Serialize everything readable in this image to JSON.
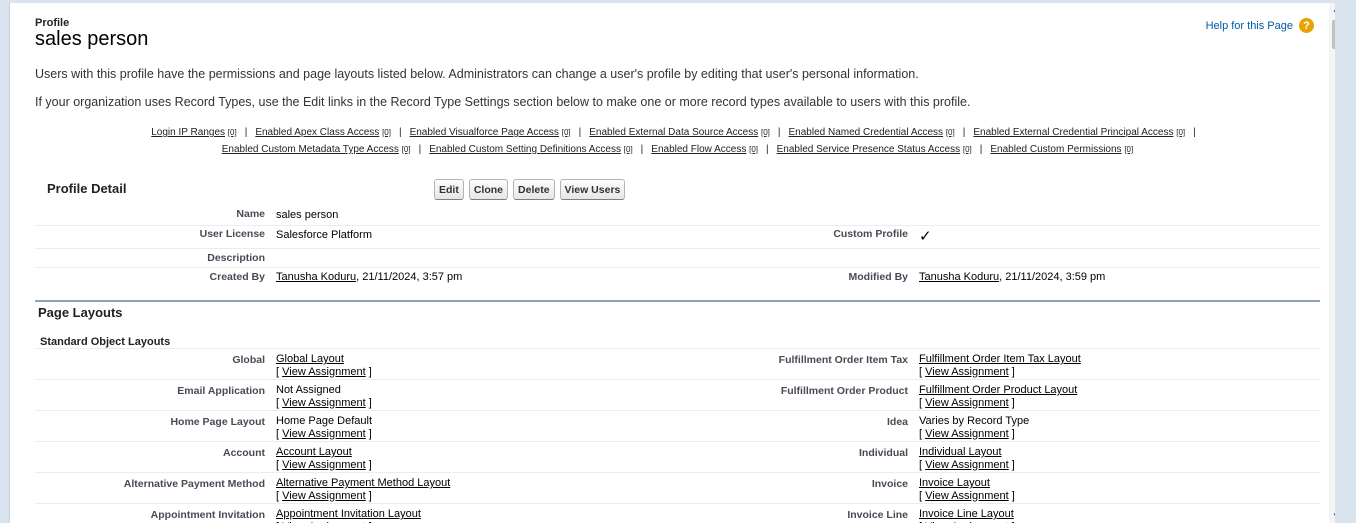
{
  "header": {
    "type_label": "Profile",
    "profile_name": "sales person",
    "help_link": "Help for this Page",
    "help_icon": "?"
  },
  "intro": {
    "line1": "Users with this profile have the permissions and page layouts listed below. Administrators can change a user's profile by editing that user's personal information.",
    "line2": "If your organization uses Record Types, use the Edit links in the Record Type Settings section below to make one or more record types available to users with this profile."
  },
  "related_links": {
    "row1": [
      {
        "label": "Login IP Ranges",
        "count": "[0]"
      },
      {
        "label": "Enabled Apex Class Access",
        "count": "[0]"
      },
      {
        "label": "Enabled Visualforce Page Access",
        "count": "[0]"
      },
      {
        "label": "Enabled External Data Source Access",
        "count": "[0]"
      },
      {
        "label": "Enabled Named Credential Access",
        "count": "[0]"
      },
      {
        "label": "Enabled External Credential Principal Access",
        "count": "[0]"
      }
    ],
    "row2": [
      {
        "label": "Enabled Custom Metadata Type Access",
        "count": "[0]"
      },
      {
        "label": "Enabled Custom Setting Definitions Access",
        "count": "[0]"
      },
      {
        "label": "Enabled Flow Access",
        "count": "[0]"
      },
      {
        "label": "Enabled Service Presence Status Access",
        "count": "[0]"
      },
      {
        "label": "Enabled Custom Permissions",
        "count": "[0]"
      }
    ],
    "separator": "|"
  },
  "profile_detail": {
    "title": "Profile Detail",
    "buttons": {
      "edit": "Edit",
      "clone": "Clone",
      "delete": "Delete",
      "view_users": "View Users"
    },
    "name_label": "Name",
    "name_value": "sales person",
    "user_license_label": "User License",
    "user_license_value": "Salesforce Platform",
    "custom_profile_label": "Custom Profile",
    "custom_profile_check": "✓",
    "description_label": "Description",
    "created_by_label": "Created By",
    "created_by_user": "Tanusha Koduru",
    "created_by_date": ", 21/11/2024, 3:57 pm",
    "modified_by_label": "Modified By",
    "modified_by_user": "Tanusha Koduru",
    "modified_by_date": ", 21/11/2024, 3:59 pm"
  },
  "page_layouts": {
    "title": "Page Layouts",
    "standard_title": "Standard Object Layouts",
    "view_assignment": "View Assignment",
    "rows": [
      {
        "left_label": "Global",
        "left_value": "Global Layout",
        "left_link": true,
        "right_label": "Fulfillment Order Item Tax",
        "right_value": "Fulfillment Order Item Tax Layout",
        "right_link": true
      },
      {
        "left_label": "Email Application",
        "left_value": "Not Assigned",
        "left_link": false,
        "right_label": "Fulfillment Order Product",
        "right_value": "Fulfillment Order Product Layout",
        "right_link": true
      },
      {
        "left_label": "Home Page Layout",
        "left_value": "Home Page Default",
        "left_link": false,
        "right_label": "Idea",
        "right_value": "Varies by Record Type",
        "right_link": false
      },
      {
        "left_label": "Account",
        "left_value": "Account Layout",
        "left_link": true,
        "right_label": "Individual",
        "right_value": "Individual Layout",
        "right_link": true
      },
      {
        "left_label": "Alternative Payment Method",
        "left_value": "Alternative Payment Method Layout",
        "left_link": true,
        "right_label": "Invoice",
        "right_value": "Invoice Layout",
        "right_link": true
      },
      {
        "left_label": "Appointment Invitation",
        "left_value": "Appointment Invitation Layout",
        "left_link": true,
        "right_label": "Invoice Line",
        "right_value": "Invoice Line Layout",
        "right_link": true
      }
    ]
  }
}
